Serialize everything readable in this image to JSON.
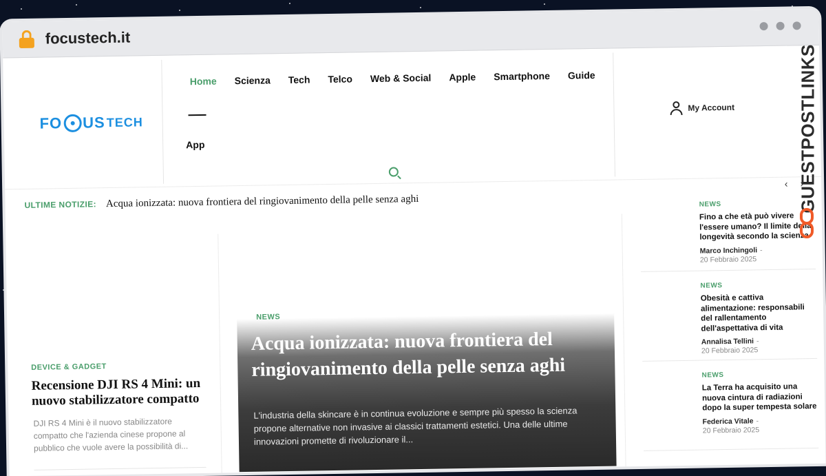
{
  "browser": {
    "domain": "focustech.it"
  },
  "logo": {
    "part1": "FO",
    "part2": "US",
    "part3": "TECH"
  },
  "nav": {
    "items": [
      "Home",
      "Scienza",
      "Tech",
      "Telco",
      "Web & Social",
      "Apple",
      "Smartphone",
      "Guide"
    ],
    "second_row": "App",
    "active": "Home"
  },
  "account": {
    "label": "My Account"
  },
  "ticker": {
    "label": "ULTIME NOTIZIE:",
    "headline": "Acqua ionizzata: nuova frontiera del ringiovanimento della pelle senza aghi",
    "prev": "‹",
    "next": "›"
  },
  "left_article": {
    "category": "DEVICE & GADGET",
    "title": "Recensione DJI RS 4 Mini: un nuovo stabilizzatore compatto",
    "excerpt": "DJI RS 4 Mini è il nuovo stabilizzatore compatto che l'azienda cinese propone al pubblico che vuole avere la possibilità di..."
  },
  "feature": {
    "category": "NEWS",
    "title": "Acqua ionizzata: nuova frontiera del ringiovanimento della pelle senza aghi",
    "excerpt": "L'industria della skincare è in continua evoluzione e sempre più spesso la scienza propone alternative non invasive ai classici trattamenti estetici. Una delle ultime innovazioni promette di rivoluzionare il..."
  },
  "sidebar": [
    {
      "category": "NEWS",
      "title": "Fino a che età può vivere l'essere umano? Il limite della longevità secondo la scienza",
      "author": "Marco Inchingoli",
      "date": "20 Febbraio 2025"
    },
    {
      "category": "NEWS",
      "title": "Obesità e cattiva alimentazione: responsabili del rallentamento dell'aspettativa di vita",
      "author": "Annalisa Tellini",
      "date": "20 Febbraio 2025"
    },
    {
      "category": "NEWS",
      "title": "La Terra ha acquisito una nuova cintura di radiazioni dopo la super tempesta solare",
      "author": "Federica Vitale",
      "date": "20 Febbraio 2025"
    }
  ],
  "watermark": {
    "text": "GUESTPOSTLINKS"
  },
  "colors": {
    "accent": "#4a9e6b",
    "logo_blue": "#1c8fe0",
    "lock": "#f4a21f",
    "watermark_orange": "#f05a28"
  }
}
